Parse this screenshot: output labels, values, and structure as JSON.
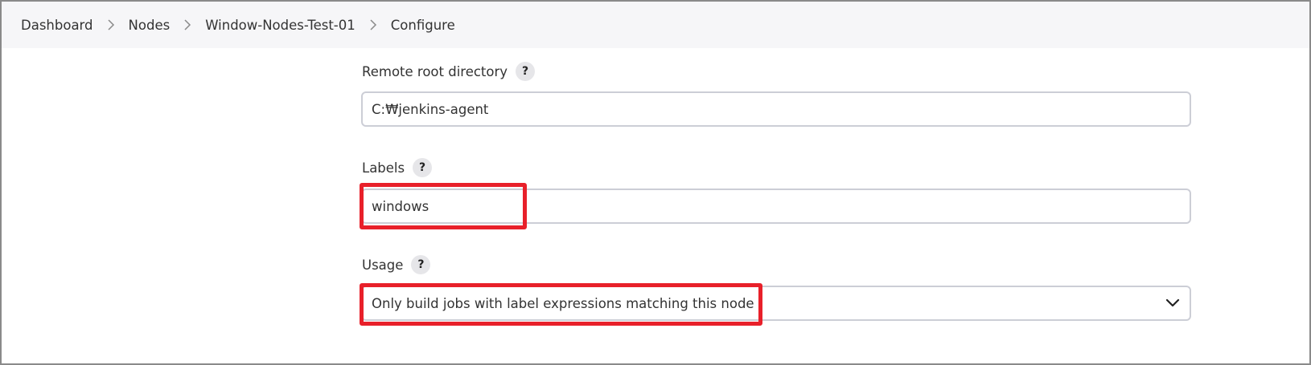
{
  "breadcrumb": {
    "items": [
      "Dashboard",
      "Nodes",
      "Window-Nodes-Test-01",
      "Configure"
    ]
  },
  "form": {
    "remote_root": {
      "label": "Remote root directory",
      "help": "?",
      "value": "C:₩jenkins-agent"
    },
    "labels": {
      "label": "Labels",
      "help": "?",
      "value": "windows"
    },
    "usage": {
      "label": "Usage",
      "help": "?",
      "selected": "Only build jobs with label expressions matching this node"
    }
  },
  "colors": {
    "highlight": "#e8202a",
    "breadcrumb_bg": "#f6f6f8",
    "input_border": "#ccced6"
  }
}
